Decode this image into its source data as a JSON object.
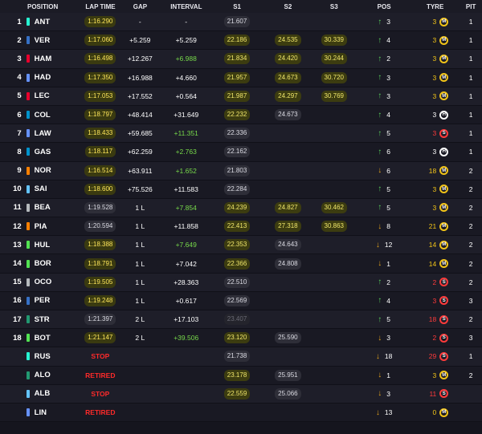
{
  "headers": [
    "POSITION",
    "LAP TIME",
    "GAP",
    "INTERVAL",
    "S1",
    "S2",
    "S3",
    "POS",
    "TYRE",
    "PIT"
  ],
  "colors": {
    "mercedes": "#27f4d2",
    "red_bull": "#3671c6",
    "ferrari": "#e8002d",
    "racing_bulls": "#6692ff",
    "alpine": "#0093cc",
    "mclaren": "#ff8000",
    "williams": "#64c4ff",
    "haas": "#b6babd",
    "sauber": "#52e252",
    "aston_martin": "#229971"
  },
  "rows": [
    {
      "pos": "1",
      "drv": "ANT",
      "team": "#27f4d2",
      "lap": "1:16.290",
      "lapStyle": "best",
      "gap": "-",
      "int": "-",
      "intStyle": "",
      "s1": "21.607",
      "s1Style": "grey",
      "s2": "",
      "s2Style": "",
      "s3": "",
      "s3Style": "",
      "dir": "up",
      "delta": "3",
      "age": "3",
      "tyre": "M",
      "pit": "1"
    },
    {
      "pos": "2",
      "drv": "VER",
      "team": "#3671c6",
      "lap": "1:17.060",
      "lapStyle": "best",
      "gap": "+5.259",
      "int": "+5.259",
      "intStyle": "",
      "s1": "22.186",
      "s1Style": "",
      "s2": "24.535",
      "s2Style": "",
      "s3": "30.339",
      "s3Style": "",
      "dir": "up",
      "delta": "4",
      "age": "3",
      "tyre": "M",
      "pit": "1"
    },
    {
      "pos": "3",
      "drv": "HAM",
      "team": "#e8002d",
      "lap": "1:16.498",
      "lapStyle": "best",
      "gap": "+12.267",
      "int": "+6.988",
      "intStyle": "green",
      "s1": "21.834",
      "s1Style": "",
      "s2": "24.420",
      "s2Style": "",
      "s3": "30.244",
      "s3Style": "",
      "dir": "up",
      "delta": "2",
      "age": "3",
      "tyre": "M",
      "pit": "1"
    },
    {
      "pos": "4",
      "drv": "HAD",
      "team": "#6692ff",
      "lap": "1:17.350",
      "lapStyle": "best",
      "gap": "+16.988",
      "int": "+4.660",
      "intStyle": "",
      "s1": "21.957",
      "s1Style": "",
      "s2": "24.673",
      "s2Style": "",
      "s3": "30.720",
      "s3Style": "",
      "dir": "up",
      "delta": "3",
      "age": "3",
      "tyre": "M",
      "pit": "1"
    },
    {
      "pos": "5",
      "drv": "LEC",
      "team": "#e8002d",
      "lap": "1:17.053",
      "lapStyle": "best",
      "gap": "+17.552",
      "int": "+0.564",
      "intStyle": "",
      "s1": "21.987",
      "s1Style": "",
      "s2": "24.297",
      "s2Style": "",
      "s3": "30.769",
      "s3Style": "",
      "dir": "up",
      "delta": "3",
      "age": "3",
      "tyre": "M",
      "pit": "1"
    },
    {
      "pos": "6",
      "drv": "COL",
      "team": "#0093cc",
      "lap": "1:18.797",
      "lapStyle": "best",
      "gap": "+48.414",
      "int": "+31.649",
      "intStyle": "",
      "s1": "22.232",
      "s1Style": "",
      "s2": "24.673",
      "s2Style": "grey",
      "s3": "",
      "s3Style": "",
      "dir": "up",
      "delta": "4",
      "age": "3",
      "tyre": "H",
      "pit": "1"
    },
    {
      "pos": "7",
      "drv": "LAW",
      "team": "#6692ff",
      "lap": "1:18.433",
      "lapStyle": "best",
      "gap": "+59.685",
      "int": "+11.351",
      "intStyle": "green",
      "s1": "22.336",
      "s1Style": "grey",
      "s2": "",
      "s2Style": "",
      "s3": "",
      "s3Style": "",
      "dir": "up",
      "delta": "5",
      "age": "3",
      "tyre": "S",
      "pit": "1"
    },
    {
      "pos": "8",
      "drv": "GAS",
      "team": "#0093cc",
      "lap": "1:18.117",
      "lapStyle": "best",
      "gap": "+62.259",
      "int": "+2.763",
      "intStyle": "green",
      "s1": "22.162",
      "s1Style": "grey",
      "s2": "",
      "s2Style": "",
      "s3": "",
      "s3Style": "",
      "dir": "up",
      "delta": "6",
      "age": "3",
      "tyre": "H",
      "pit": "1"
    },
    {
      "pos": "9",
      "drv": "NOR",
      "team": "#ff8000",
      "lap": "1:16.514",
      "lapStyle": "best",
      "gap": "+63.911",
      "int": "+1.652",
      "intStyle": "green",
      "s1": "21.803",
      "s1Style": "grey",
      "s2": "",
      "s2Style": "",
      "s3": "",
      "s3Style": "",
      "dir": "down",
      "delta": "6",
      "age": "18",
      "tyre": "M",
      "pit": "2"
    },
    {
      "pos": "10",
      "drv": "SAI",
      "team": "#64c4ff",
      "lap": "1:18.600",
      "lapStyle": "best",
      "gap": "+75.526",
      "int": "+11.583",
      "intStyle": "",
      "s1": "22.284",
      "s1Style": "grey",
      "s2": "",
      "s2Style": "",
      "s3": "",
      "s3Style": "",
      "dir": "up",
      "delta": "5",
      "age": "3",
      "tyre": "M",
      "pit": "2"
    },
    {
      "pos": "11",
      "drv": "BEA",
      "team": "#b6babd",
      "lap": "1:19.528",
      "lapStyle": "grey",
      "gap": "1 L",
      "int": "+7.854",
      "intStyle": "green",
      "s1": "24.239",
      "s1Style": "",
      "s2": "24.827",
      "s2Style": "",
      "s3": "30.462",
      "s3Style": "",
      "dir": "up",
      "delta": "5",
      "age": "3",
      "tyre": "M",
      "pit": "2"
    },
    {
      "pos": "12",
      "drv": "PIA",
      "team": "#ff8000",
      "lap": "1:20.594",
      "lapStyle": "grey",
      "gap": "1 L",
      "int": "+11.858",
      "intStyle": "",
      "s1": "22.413",
      "s1Style": "",
      "s2": "27.318",
      "s2Style": "",
      "s3": "30.863",
      "s3Style": "",
      "dir": "down",
      "delta": "8",
      "age": "21",
      "tyre": "M",
      "pit": "2"
    },
    {
      "pos": "13",
      "drv": "HUL",
      "team": "#52e252",
      "lap": "1:18.388",
      "lapStyle": "best",
      "gap": "1 L",
      "int": "+7.649",
      "intStyle": "green",
      "s1": "22.353",
      "s1Style": "",
      "s2": "24.643",
      "s2Style": "grey",
      "s3": "",
      "s3Style": "",
      "dir": "down",
      "delta": "12",
      "age": "14",
      "tyre": "M",
      "pit": "2"
    },
    {
      "pos": "14",
      "drv": "BOR",
      "team": "#52e252",
      "lap": "1:18.791",
      "lapStyle": "best",
      "gap": "1 L",
      "int": "+7.042",
      "intStyle": "",
      "s1": "22.366",
      "s1Style": "",
      "s2": "24.808",
      "s2Style": "grey",
      "s3": "",
      "s3Style": "",
      "dir": "down",
      "delta": "1",
      "age": "14",
      "tyre": "M",
      "pit": "2"
    },
    {
      "pos": "15",
      "drv": "OCO",
      "team": "#b6babd",
      "lap": "1:19.505",
      "lapStyle": "best",
      "gap": "1 L",
      "int": "+28.363",
      "intStyle": "",
      "s1": "22.510",
      "s1Style": "grey",
      "s2": "",
      "s2Style": "",
      "s3": "",
      "s3Style": "",
      "dir": "up",
      "delta": "2",
      "age": "2",
      "tyre": "S",
      "pit": "2"
    },
    {
      "pos": "16",
      "drv": "PER",
      "team": "#3671c6",
      "lap": "1:19.248",
      "lapStyle": "best",
      "gap": "1 L",
      "int": "+0.617",
      "intStyle": "",
      "s1": "22.569",
      "s1Style": "grey",
      "s2": "",
      "s2Style": "",
      "s3": "",
      "s3Style": "",
      "dir": "up",
      "delta": "4",
      "age": "3",
      "tyre": "S",
      "pit": "3"
    },
    {
      "pos": "17",
      "drv": "STR",
      "team": "#229971",
      "lap": "1:21.397",
      "lapStyle": "grey",
      "gap": "2 L",
      "int": "+17.103",
      "intStyle": "",
      "s1": "23.407",
      "s1Style": "dim",
      "s2": "",
      "s2Style": "",
      "s3": "",
      "s3Style": "",
      "dir": "up",
      "delta": "5",
      "age": "18",
      "tyre": "S",
      "pit": "2"
    },
    {
      "pos": "18",
      "drv": "BOT",
      "team": "#52e252",
      "lap": "1:21.147",
      "lapStyle": "best",
      "gap": "2 L",
      "int": "+39.506",
      "intStyle": "green",
      "s1": "23.120",
      "s1Style": "",
      "s2": "25.590",
      "s2Style": "grey",
      "s3": "",
      "s3Style": "",
      "dir": "down",
      "delta": "3",
      "age": "2",
      "tyre": "S",
      "pit": "3"
    },
    {
      "pos": "",
      "drv": "RUS",
      "team": "#27f4d2",
      "lap": "STOP",
      "lapStyle": "red",
      "gap": "",
      "int": "",
      "intStyle": "",
      "s1": "21.738",
      "s1Style": "grey",
      "s2": "",
      "s2Style": "",
      "s3": "",
      "s3Style": "",
      "dir": "down",
      "delta": "18",
      "age": "29",
      "tyre": "S",
      "pit": "1"
    },
    {
      "pos": "",
      "drv": "ALO",
      "team": "#229971",
      "lap": "RETIRED",
      "lapStyle": "red",
      "gap": "",
      "int": "",
      "intStyle": "",
      "s1": "23.178",
      "s1Style": "",
      "s2": "25.951",
      "s2Style": "grey",
      "s3": "",
      "s3Style": "",
      "dir": "down",
      "delta": "1",
      "age": "3",
      "tyre": "M",
      "pit": "2"
    },
    {
      "pos": "",
      "drv": "ALB",
      "team": "#64c4ff",
      "lap": "STOP",
      "lapStyle": "red",
      "gap": "",
      "int": "",
      "intStyle": "",
      "s1": "22.559",
      "s1Style": "",
      "s2": "25.066",
      "s2Style": "grey",
      "s3": "",
      "s3Style": "",
      "dir": "down",
      "delta": "3",
      "age": "11",
      "tyre": "S",
      "pit": ""
    },
    {
      "pos": "",
      "drv": "LIN",
      "team": "#6692ff",
      "lap": "RETIRED",
      "lapStyle": "red",
      "gap": "",
      "int": "",
      "intStyle": "",
      "s1": "",
      "s1Style": "",
      "s2": "",
      "s2Style": "",
      "s3": "",
      "s3Style": "",
      "dir": "down",
      "delta": "13",
      "age": "0",
      "tyre": "M",
      "pit": ""
    }
  ]
}
